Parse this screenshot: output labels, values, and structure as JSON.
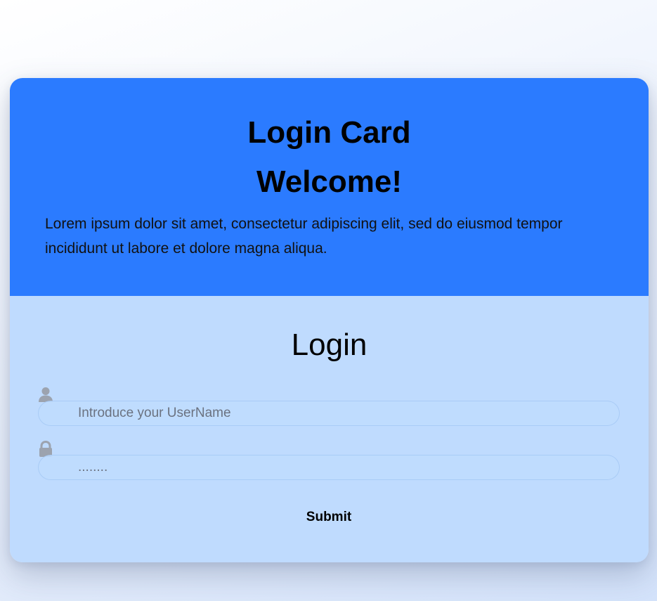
{
  "header": {
    "title": "Login Card",
    "welcome": "Welcome!",
    "description": "Lorem ipsum dolor sit amet, consectetur adipiscing elit, sed do eiusmod tempor incididunt ut labore et dolore magna aliqua."
  },
  "form": {
    "heading": "Login",
    "username": {
      "icon": "user-icon",
      "placeholder": "Introduce your UserName",
      "value": ""
    },
    "password": {
      "icon": "lock-icon",
      "value": "........"
    },
    "submit_label": "Submit"
  },
  "colors": {
    "header_bg": "#2b7bff",
    "form_bg": "#bfdbfe",
    "icon": "#9ca3af"
  }
}
